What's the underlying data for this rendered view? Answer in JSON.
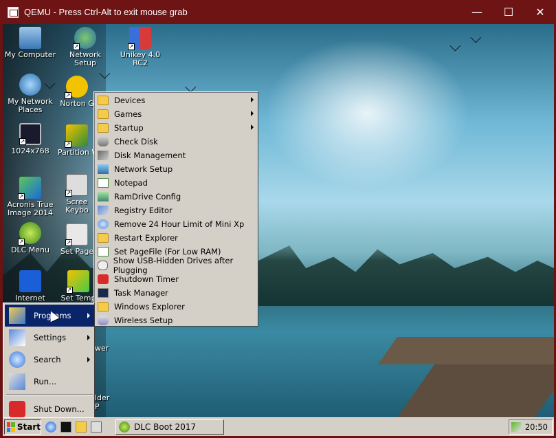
{
  "window": {
    "title": "QEMU - Press Ctrl-Alt to exit mouse grab",
    "minimize": "—",
    "maximize": "☐",
    "close": "✕"
  },
  "desktop_icons": [
    {
      "label": "My Computer",
      "icon": "computer-icon"
    },
    {
      "label": "Network Setup",
      "icon": "network-icon"
    },
    {
      "label": "Unikey 4.0 RC2",
      "icon": "unikey-icon"
    },
    {
      "label": "My Network Places",
      "icon": "network-places-icon"
    },
    {
      "label": "Norton G",
      "icon": "norton-icon"
    },
    {
      "label": "1024x768",
      "icon": "monitor-icon"
    },
    {
      "label": "Partition W",
      "icon": "partition-icon"
    },
    {
      "label": "Acronis True Image 2014",
      "icon": "acronis-icon"
    },
    {
      "label": "Scree Keybo",
      "icon": "keyboard-icon"
    },
    {
      "label": "DLC Menu",
      "icon": "dlc-menu-icon"
    },
    {
      "label": "Set Page",
      "icon": "pagefile-icon"
    },
    {
      "label": "Internet",
      "icon": "maxthon-icon"
    },
    {
      "label": "Set Temp",
      "icon": "settemp-icon"
    }
  ],
  "partial_labels": {
    "wer": "wer",
    "lder": "lder",
    "p": "P"
  },
  "programs_menu": {
    "items": [
      {
        "label": "Devices",
        "icon": "folder-icon",
        "submenu": true
      },
      {
        "label": "Games",
        "icon": "folder-icon",
        "submenu": true
      },
      {
        "label": "Startup",
        "icon": "folder-icon",
        "submenu": true
      },
      {
        "label": "Check Disk",
        "icon": "disk-icon",
        "submenu": false
      },
      {
        "label": "Disk Management",
        "icon": "disk-management-icon",
        "submenu": false
      },
      {
        "label": "Network Setup",
        "icon": "network-icon",
        "submenu": false
      },
      {
        "label": "Notepad",
        "icon": "notepad-icon",
        "submenu": false
      },
      {
        "label": "RamDrive Config",
        "icon": "ramdrive-icon",
        "submenu": false
      },
      {
        "label": "Registry Editor",
        "icon": "registry-icon",
        "submenu": false
      },
      {
        "label": "Remove 24 Hour Limit of Mini Xp",
        "icon": "refresh-icon",
        "submenu": false
      },
      {
        "label": "Restart Explorer",
        "icon": "folder-icon",
        "submenu": false
      },
      {
        "label": "Set PageFile (For Low RAM)",
        "icon": "pagefile-icon",
        "submenu": false
      },
      {
        "label": "Show USB-Hidden Drives after Plugging",
        "icon": "usb-icon",
        "submenu": false
      },
      {
        "label": "Shutdown Timer",
        "icon": "power-icon",
        "submenu": false
      },
      {
        "label": "Task Manager",
        "icon": "task-manager-icon",
        "submenu": false
      },
      {
        "label": "Windows Explorer",
        "icon": "folder-icon",
        "submenu": false
      },
      {
        "label": "Wireless Setup",
        "icon": "wireless-icon",
        "submenu": false
      }
    ]
  },
  "start_menu": {
    "items": [
      {
        "label": "Programs",
        "icon": "programs-icon",
        "submenu": true,
        "active": true
      },
      {
        "label": "Settings",
        "icon": "settings-icon",
        "submenu": true,
        "active": false
      },
      {
        "label": "Search",
        "icon": "search-icon",
        "submenu": true,
        "active": false
      },
      {
        "label": "Run...",
        "icon": "run-icon",
        "submenu": false,
        "active": false
      },
      {
        "label": "Shut Down...",
        "icon": "shutdown-icon",
        "submenu": false,
        "active": false
      }
    ]
  },
  "taskbar": {
    "start_label": "Start",
    "task_label": "DLC Boot 2017",
    "clock": "20:50"
  },
  "colors": {
    "titlebar": "#6e1414",
    "menu_bg": "#d4d0c8",
    "highlight": "#0a246a"
  }
}
